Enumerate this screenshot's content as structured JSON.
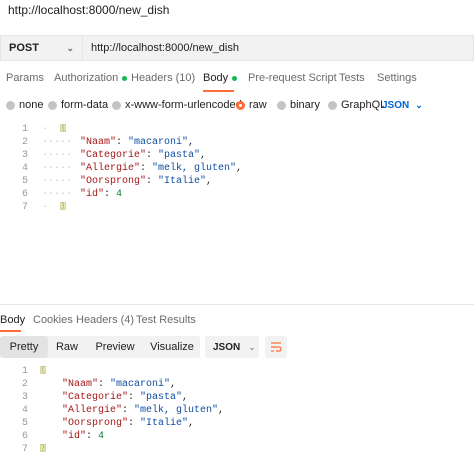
{
  "request": {
    "title": "http://localhost:8000/new_dish",
    "method": "POST",
    "url": "http://localhost:8000/new_dish"
  },
  "tabs": {
    "params": "Params",
    "authorization": "Authorization",
    "headers": "Headers (10)",
    "body": "Body",
    "pre_request": "Pre-request Script",
    "tests": "Tests",
    "settings": "Settings"
  },
  "body_options": {
    "none": "none",
    "form_data": "form-data",
    "urlencoded": "x-www-form-urlencoded",
    "raw": "raw",
    "binary": "binary",
    "graphql": "GraphQL",
    "format": "JSON"
  },
  "request_body": {
    "line_numbers": [
      "1",
      "2",
      "3",
      "4",
      "5",
      "6",
      "7"
    ],
    "fields": [
      {
        "key": "\"Naam\"",
        "value": "\"macaroni\""
      },
      {
        "key": "\"Categorie\"",
        "value": "\"pasta\""
      },
      {
        "key": "\"Allergie\"",
        "value": "\"melk, gluten\""
      },
      {
        "key": "\"Oorsprong\"",
        "value": "\"Italie\""
      },
      {
        "key": "\"id\"",
        "value": "4"
      }
    ]
  },
  "response_tabs": {
    "body": "Body",
    "cookies": "Cookies",
    "headers": "Headers (4)",
    "test_results": "Test Results"
  },
  "response_view": {
    "pretty": "Pretty",
    "raw": "Raw",
    "preview": "Preview",
    "visualize": "Visualize",
    "format": "JSON"
  },
  "response_body": {
    "line_numbers": [
      "1",
      "2",
      "3",
      "4",
      "5",
      "6",
      "7"
    ],
    "fields": [
      {
        "key": "\"Naam\"",
        "value": "\"macaroni\""
      },
      {
        "key": "\"Categorie\"",
        "value": "\"pasta\""
      },
      {
        "key": "\"Allergie\"",
        "value": "\"melk, gluten\""
      },
      {
        "key": "\"Oorsprong\"",
        "value": "\"Italie\""
      },
      {
        "key": "\"id\"",
        "value": "4"
      }
    ]
  },
  "colors": {
    "accent": "#ff6c37",
    "dot_green": "#0cbb52",
    "json_blue": "#0265d2"
  }
}
